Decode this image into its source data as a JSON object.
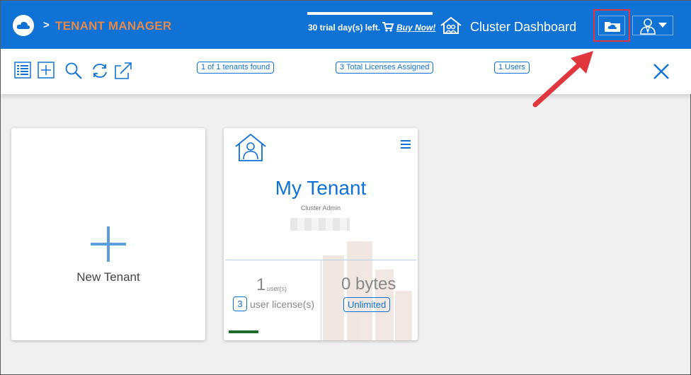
{
  "header": {
    "breadcrumb_sep": ">",
    "title": "TENANT MANAGER",
    "trial_text": "30 trial day(s) left.",
    "buy_now": "Buy Now!",
    "cluster_label": "Cluster Dashboard",
    "icons": [
      "cloud-logo-icon",
      "cart-icon",
      "house-icon",
      "cloud-folder-icon",
      "user-icon",
      "caret-down-icon"
    ]
  },
  "toolbar": {
    "icons": [
      "list-icon",
      "add-icon",
      "search-icon",
      "refresh-icon",
      "export-icon",
      "close-icon"
    ],
    "tenants_found": "1 of 1 tenants found",
    "licenses": "3 Total Licenses Assigned",
    "users": "1 Users"
  },
  "new_tenant": {
    "label": "New Tenant"
  },
  "tenant": {
    "name": "My Tenant",
    "role": "Cluster Admin",
    "user_count": "1",
    "user_unit": "user(s)",
    "license_count": "3",
    "license_label": "user license(s)",
    "storage": "0 bytes",
    "storage_limit": "Unlimited"
  },
  "colors": {
    "brand": "#0f72d4",
    "title_accent": "#e8894a",
    "highlight": "#e0373f",
    "progress": "#1e6b2b"
  }
}
